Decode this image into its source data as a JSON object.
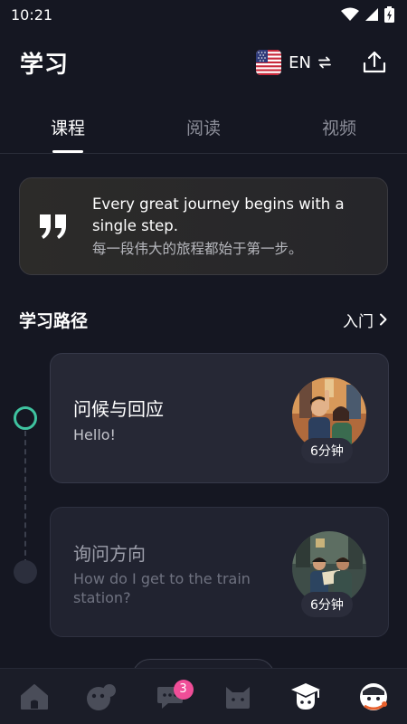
{
  "status_bar": {
    "time": "10:21"
  },
  "header": {
    "title": "学习",
    "language_code": "EN"
  },
  "tabs": [
    {
      "label": "课程",
      "active": true
    },
    {
      "label": "阅读",
      "active": false
    },
    {
      "label": "视频",
      "active": false
    }
  ],
  "quote": {
    "english": "Every great journey begins with a single step.",
    "chinese": "每一段伟大的旅程都始于第一步。"
  },
  "learning_path": {
    "title": "学习路径",
    "level": "入门",
    "lessons": [
      {
        "title": "问候与回应",
        "subtitle": "Hello!",
        "duration": "6分钟",
        "state": "current"
      },
      {
        "title": "询问方向",
        "subtitle": "How do I get to the train station?",
        "duration": "6分钟",
        "state": "locked"
      }
    ]
  },
  "bottom_nav": {
    "items": [
      {
        "icon": "home-icon"
      },
      {
        "icon": "game-controller-icon"
      },
      {
        "icon": "chat-icon",
        "badge": "3"
      },
      {
        "icon": "cat-icon"
      },
      {
        "icon": "graduation-cap-icon",
        "active": true
      },
      {
        "icon": "mascot-avatar-icon"
      }
    ]
  },
  "colors": {
    "background": "#151722",
    "accent_green": "#3fc3a0",
    "badge_pink": "#f04e98",
    "card": "#262835"
  }
}
